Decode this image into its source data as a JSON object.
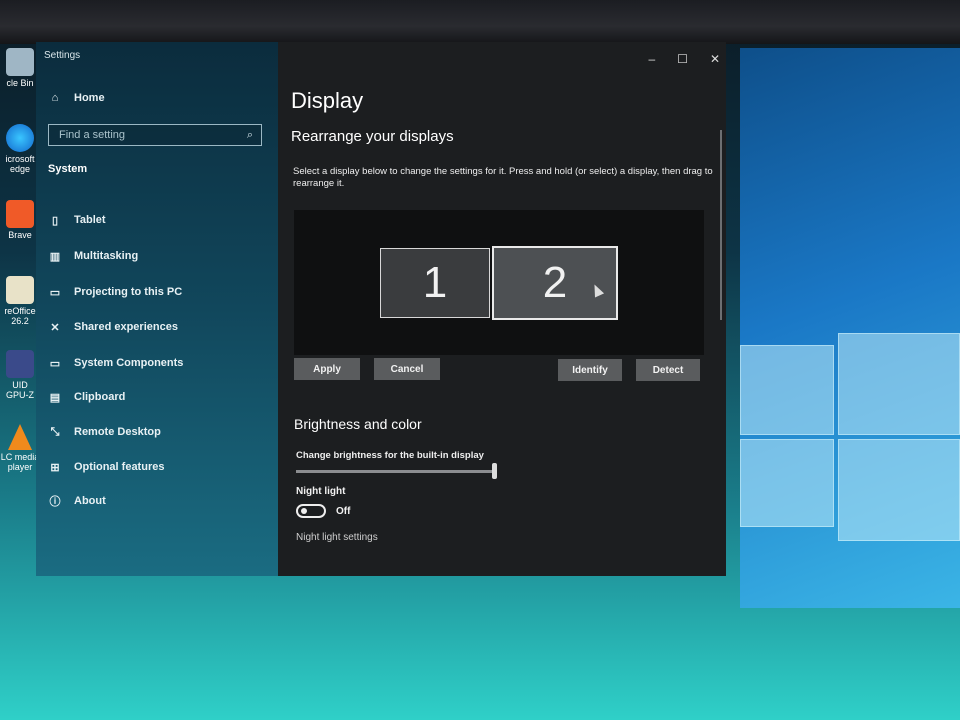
{
  "window": {
    "app_title": "Settings",
    "controls": {
      "minimize": "–",
      "maximize": "☐",
      "close": "✕"
    }
  },
  "sidebar": {
    "home": {
      "icon": "home-icon",
      "label": "Home"
    },
    "search": {
      "placeholder": "Find a setting",
      "icon": "search-icon"
    },
    "section_label": "System",
    "items": [
      {
        "icon": "tablet-icon",
        "label": "Tablet"
      },
      {
        "icon": "multitasking-icon",
        "label": "Multitasking"
      },
      {
        "icon": "projecting-icon",
        "label": "Projecting to this PC"
      },
      {
        "icon": "shared-experiences-icon",
        "label": "Shared experiences"
      },
      {
        "icon": "system-components-icon",
        "label": "System Components"
      },
      {
        "icon": "clipboard-icon",
        "label": "Clipboard"
      },
      {
        "icon": "remote-desktop-icon",
        "label": "Remote Desktop"
      },
      {
        "icon": "optional-features-icon",
        "label": "Optional features"
      },
      {
        "icon": "about-icon",
        "label": "About"
      }
    ]
  },
  "main": {
    "page_title": "Display",
    "rearrange_heading": "Rearrange your displays",
    "rearrange_description": "Select a display below to change the settings for it. Press and hold (or select) a display, then drag to rearrange it.",
    "monitors": [
      {
        "number": "1",
        "selected": false
      },
      {
        "number": "2",
        "selected": true
      }
    ],
    "buttons": {
      "apply": "Apply",
      "cancel": "Cancel",
      "identify": "Identify",
      "detect": "Detect"
    },
    "brightness_heading": "Brightness and color",
    "brightness_label": "Change brightness for the built-in display",
    "brightness_value": 1.0,
    "night_light_label": "Night light",
    "night_light_state": "Off",
    "night_light_settings_link": "Night light settings"
  },
  "desktop_icons": [
    {
      "icon": "recycle-bin-icon",
      "label": "cle Bin"
    },
    {
      "icon": "edge-icon",
      "label": "icrosoft\nedge"
    },
    {
      "icon": "brave-icon",
      "label": "Brave"
    },
    {
      "icon": "libreoffice-icon",
      "label": "reOffice\n26.2"
    },
    {
      "icon": "gpuz-icon",
      "label": "UID GPU-Z"
    },
    {
      "icon": "vlc-icon",
      "label": "LC media\nplayer"
    }
  ]
}
